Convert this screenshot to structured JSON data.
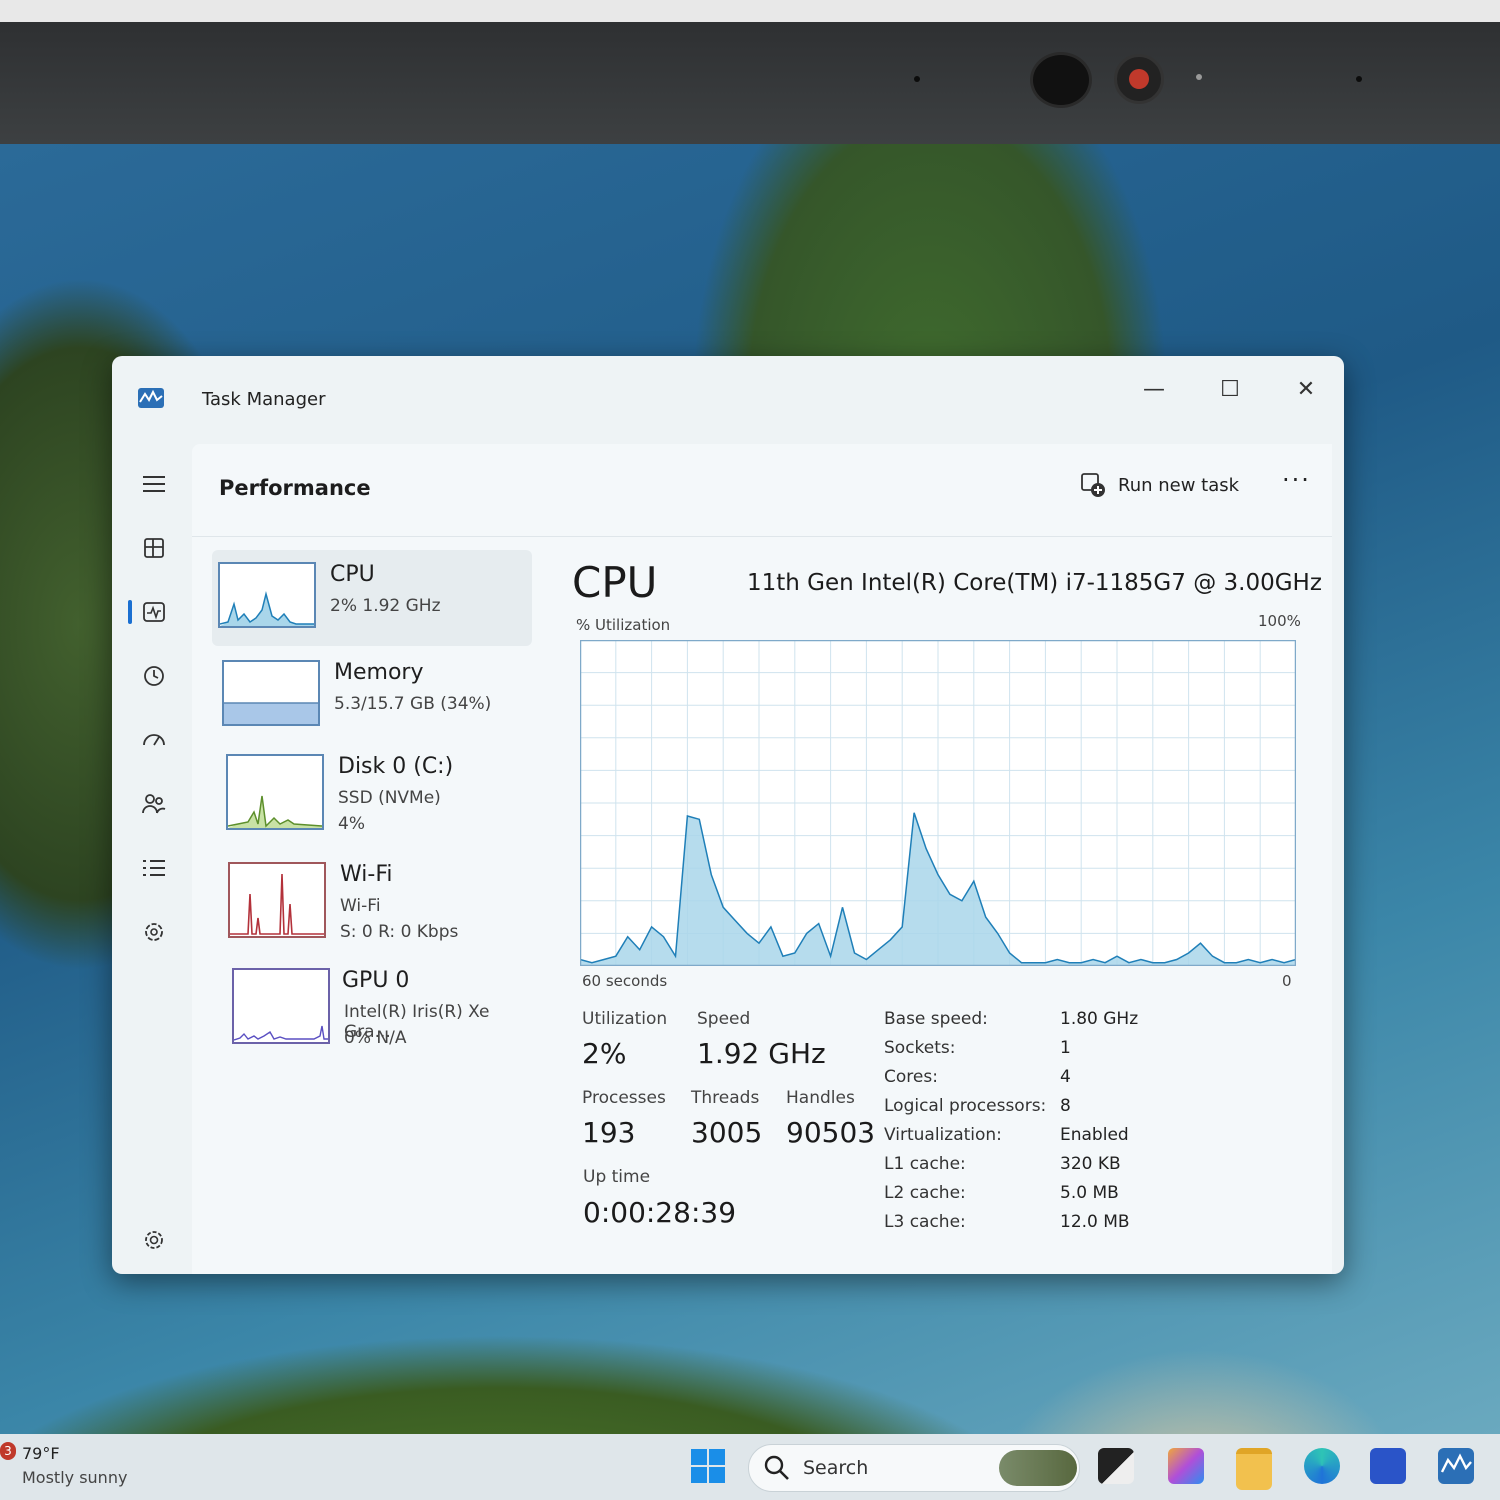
{
  "window": {
    "title": "Task Manager",
    "controls": {
      "minimize": "—",
      "maximize": "☐",
      "close": "✕"
    }
  },
  "header": {
    "page_title": "Performance",
    "run_new_task": "Run new task",
    "more": "···"
  },
  "sidebar": {
    "icons": [
      "hamburger-menu-icon",
      "processes-icon",
      "performance-icon",
      "app-history-icon",
      "startup-apps-icon",
      "users-icon",
      "details-icon",
      "services-icon",
      "settings-icon"
    ],
    "selected": "performance-icon"
  },
  "resources": [
    {
      "name": "CPU",
      "line1": "2%  1.92 GHz",
      "line2": "",
      "line3": ""
    },
    {
      "name": "Memory",
      "line1": "5.3/15.7 GB (34%)",
      "line2": "",
      "line3": ""
    },
    {
      "name": "Disk 0 (C:)",
      "line1": "SSD (NVMe)",
      "line2": "4%",
      "line3": ""
    },
    {
      "name": "Wi-Fi",
      "line1": "Wi-Fi",
      "line2": "S: 0 R: 0 Kbps",
      "line3": ""
    },
    {
      "name": "GPU 0",
      "line1": "Intel(R) Iris(R) Xe Gra...",
      "line2": "0%  N/A",
      "line3": ""
    }
  ],
  "detail": {
    "title": "CPU",
    "model": "11th Gen Intel(R) Core(TM) i7-1185G7 @ 3.00GHz",
    "util_label": "% Utilization",
    "max_label": "100%",
    "time_label": "60 seconds",
    "min_label": "0"
  },
  "stats": {
    "utilization": {
      "label": "Utilization",
      "value": "2%"
    },
    "speed": {
      "label": "Speed",
      "value": "1.92 GHz"
    },
    "processes": {
      "label": "Processes",
      "value": "193"
    },
    "threads": {
      "label": "Threads",
      "value": "3005"
    },
    "handles": {
      "label": "Handles",
      "value": "90503"
    },
    "uptime": {
      "label": "Up time",
      "value": "0:00:28:39"
    }
  },
  "specs": [
    {
      "key": "Base speed:",
      "value": "1.80 GHz"
    },
    {
      "key": "Sockets:",
      "value": "1"
    },
    {
      "key": "Cores:",
      "value": "4"
    },
    {
      "key": "Logical processors:",
      "value": "8"
    },
    {
      "key": "Virtualization:",
      "value": "Enabled"
    },
    {
      "key": "L1 cache:",
      "value": "320 KB"
    },
    {
      "key": "L2 cache:",
      "value": "5.0 MB"
    },
    {
      "key": "L3 cache:",
      "value": "12.0 MB"
    }
  ],
  "chart_data": {
    "type": "area",
    "title": "",
    "xlabel": "60 seconds",
    "ylabel": "% Utilization",
    "xlim": [
      60,
      0
    ],
    "ylim": [
      0,
      100
    ],
    "grid": true,
    "x": [
      60,
      59,
      58,
      57,
      56,
      55,
      54,
      53,
      52,
      51,
      50,
      49,
      48,
      47,
      46,
      45,
      44,
      43,
      42,
      41,
      40,
      39,
      38,
      37,
      36,
      35,
      34,
      33,
      32,
      31,
      30,
      29,
      28,
      27,
      26,
      25,
      24,
      23,
      22,
      21,
      20,
      19,
      18,
      17,
      16,
      15,
      14,
      13,
      12,
      11,
      10,
      9,
      8,
      7,
      6,
      5,
      4,
      3,
      2,
      1,
      0
    ],
    "series": [
      {
        "values": [
          2,
          1,
          2,
          3,
          9,
          5,
          12,
          9,
          3,
          46,
          45,
          28,
          18,
          14,
          10,
          7,
          12,
          3,
          4,
          10,
          13,
          3,
          18,
          4,
          2,
          5,
          8,
          12,
          47,
          36,
          28,
          22,
          20,
          26,
          15,
          10,
          4,
          1,
          1,
          1,
          2,
          1,
          1,
          2,
          1,
          3,
          1,
          2,
          1,
          1,
          2,
          4,
          7,
          3,
          1,
          1,
          2,
          1,
          2,
          1,
          2
        ]
      }
    ],
    "colors": {
      "line": "#1f7fb8",
      "fill": "#a9d6ea",
      "grid": "#cfe3ee",
      "border": "#7fa9c9"
    }
  },
  "taskbar": {
    "weather_temp": "79°F",
    "weather_desc": "Mostly sunny",
    "weather_badge": "3",
    "search_label": "Search"
  }
}
